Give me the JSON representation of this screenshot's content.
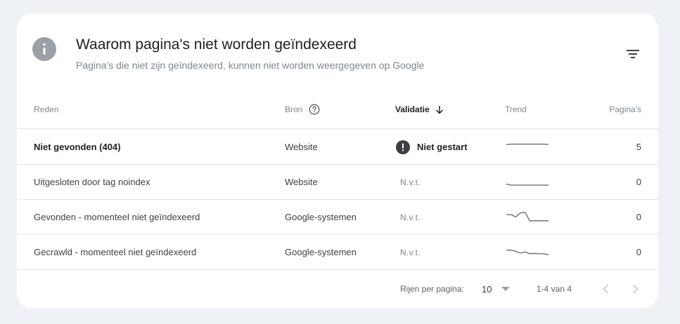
{
  "header": {
    "title": "Waarom pagina's niet worden geïndexeerd",
    "subtitle": "Pagina's die niet zijn geïndexeerd, kunnen niet worden weergegeven op Google"
  },
  "columns": {
    "reden": "Reden",
    "bron": "Bron",
    "validatie": "Validatie",
    "trend": "Trend",
    "paginas": "Pagina's"
  },
  "rows": [
    {
      "reden": "Niet gevonden (404)",
      "bron": "Website",
      "validatie": "Niet gestart",
      "paginas": "5",
      "trend": [
        0.75,
        0.78,
        0.78,
        0.78,
        0.78,
        0.78,
        0.78,
        0.78,
        0.78,
        0.75
      ]
    },
    {
      "reden": "Uitgesloten door tag noindex",
      "bron": "Website",
      "validatie": "N.v.t.",
      "paginas": "0",
      "trend": [
        0.35,
        0.25,
        0.25,
        0.25,
        0.25,
        0.25,
        0.25,
        0.25,
        0.25,
        0.25
      ]
    },
    {
      "reden": "Gevonden - momenteel niet geïndexeerd",
      "bron": "Google-systemen",
      "validatie": "N.v.t.",
      "paginas": "0",
      "trend": [
        0.75,
        0.75,
        0.55,
        0.9,
        0.95,
        0.2,
        0.2,
        0.2,
        0.2,
        0.2
      ]
    },
    {
      "reden": "Gecrawld - momenteel niet geïndexeerd",
      "bron": "Google-systemen",
      "validatie": "N.v.t.",
      "paginas": "0",
      "trend": [
        0.7,
        0.72,
        0.6,
        0.45,
        0.55,
        0.38,
        0.42,
        0.38,
        0.38,
        0.3
      ]
    }
  ],
  "footer": {
    "rows_per_page_label": "Rijen per pagina:",
    "rows_per_page_value": "10",
    "range": "1-4 van 4"
  },
  "colors": {
    "background": "#eef1f6",
    "card": "#ffffff",
    "info_icon": "#9aa0a6",
    "warn_icon": "#3c4043",
    "divider": "#e3e5e8",
    "trend_line": "#5f6368"
  },
  "icons": {
    "header": "info-icon",
    "filter": "filter-icon",
    "help": "help-icon",
    "sort": "arrow-down-icon",
    "status": "exclamation-icon",
    "select": "caret-down-icon",
    "prev": "chevron-left-icon",
    "next": "chevron-right-icon"
  }
}
